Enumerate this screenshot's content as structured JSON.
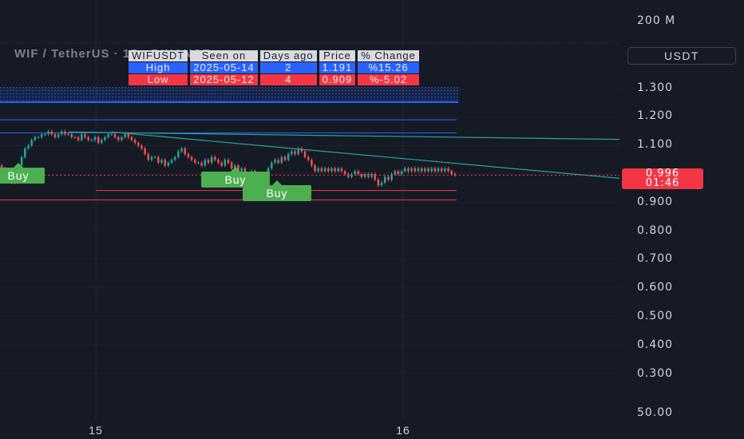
{
  "header": {
    "symbol": "WIF / TetherUS · 15 · BINANCE"
  },
  "stats_table": {
    "columns": [
      "WIFUSDT",
      "Seen on",
      "Days ago",
      "Price",
      "% Change"
    ],
    "rows": [
      {
        "type": "High",
        "seen_on": "2025-05-14",
        "days_ago": "2",
        "price": "1.191",
        "change": "%15.26"
      },
      {
        "type": "Low",
        "seen_on": "2025-05-12",
        "days_ago": "4",
        "price": "0.909",
        "change": "%-5.02"
      }
    ]
  },
  "price_axis": {
    "currency": "USDT",
    "volume_label": "200 M",
    "volume_bottom_label": "50.00",
    "ticks": [
      "1.300",
      "1.200",
      "1.100",
      "0.900",
      "0.800",
      "0.700",
      "0.600",
      "0.500",
      "0.400",
      "0.300"
    ],
    "current_price": "0.996",
    "countdown": "01:46"
  },
  "time_axis": {
    "labels": [
      "15",
      "16"
    ]
  },
  "signals": [
    "Buy",
    "Buy",
    "Buy"
  ],
  "colors": {
    "background": "#161a25",
    "up": "#26a69a",
    "down": "#ef5350",
    "buy": "#4caf50",
    "high_row": "#2962ff",
    "low_row": "#f23645"
  },
  "chart_data": {
    "type": "candlestick",
    "ylim": [
      0.255,
      1.405
    ],
    "x_ticks": [
      "15",
      "16"
    ],
    "close_series": [
      1.02,
      1.01,
      0.98,
      0.97,
      0.99,
      1.03,
      1.06,
      1.09,
      1.1,
      1.12,
      1.13,
      1.13,
      1.14,
      1.14,
      1.15,
      1.14,
      1.13,
      1.14,
      1.15,
      1.14,
      1.14,
      1.13,
      1.13,
      1.12,
      1.14,
      1.13,
      1.12,
      1.12,
      1.13,
      1.11,
      1.12,
      1.13,
      1.14,
      1.14,
      1.13,
      1.12,
      1.13,
      1.14,
      1.13,
      1.12,
      1.11,
      1.1,
      1.09,
      1.07,
      1.05,
      1.06,
      1.06,
      1.04,
      1.05,
      1.03,
      1.04,
      1.05,
      1.06,
      1.08,
      1.09,
      1.07,
      1.06,
      1.05,
      1.04,
      1.04,
      1.03,
      1.05,
      1.04,
      1.06,
      1.05,
      1.04,
      1.03,
      1.05,
      1.04,
      1.02,
      1.03,
      1.01,
      1.02,
      1.0,
      0.99,
      1.01,
      0.97,
      0.98,
      1.0,
      0.99,
      1.02,
      1.04,
      1.05,
      1.04,
      1.06,
      1.05,
      1.07,
      1.08,
      1.07,
      1.09,
      1.08,
      1.06,
      1.05,
      1.03,
      1.01,
      1.02,
      1.01,
      1.02,
      1.01,
      1.02,
      1.01,
      1.02,
      1.01,
      1.0,
      0.99,
      1.0,
      1.01,
      1.0,
      0.99,
      1.0,
      0.99,
      1.0,
      0.98,
      0.96,
      0.97,
      0.99,
      0.98,
      1.0,
      1.01,
      1.0,
      1.01,
      1.02,
      1.01,
      1.02,
      1.01,
      1.02,
      1.01,
      1.02,
      1.01,
      1.02,
      1.01,
      1.02,
      1.01,
      1.02,
      1.01,
      1.0,
      0.996
    ],
    "support_resistance": [
      {
        "name": "high",
        "y": 1.191
      },
      {
        "name": "level",
        "y": 1.145
      },
      {
        "name": "level",
        "y": 0.942
      },
      {
        "name": "low",
        "y": 0.909
      }
    ],
    "zone": {
      "y_top": 1.305,
      "y_bottom": 1.253
    },
    "trendlines": [
      {
        "x0": 0.11,
        "y0": 1.148,
        "x1": 1.0,
        "y1": 1.122
      },
      {
        "x0": 0.18,
        "y0": 1.148,
        "x1": 1.0,
        "y1": 0.985
      }
    ]
  }
}
